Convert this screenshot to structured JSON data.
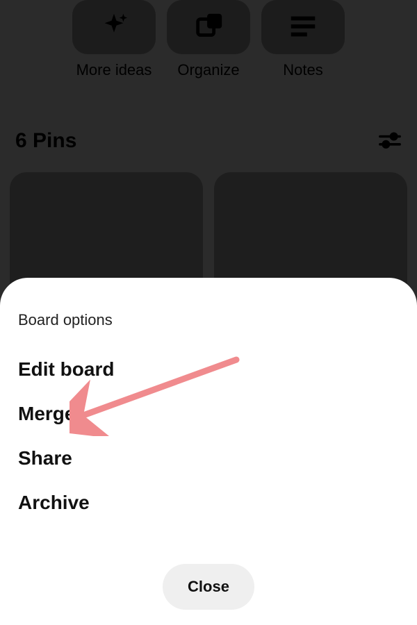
{
  "actions": {
    "more_ideas": "More ideas",
    "organize": "Organize",
    "notes": "Notes"
  },
  "pins_header": {
    "count_label": "6 Pins"
  },
  "sheet": {
    "title": "Board options",
    "edit_board": "Edit board",
    "merge": "Merge",
    "share": "Share",
    "archive": "Archive",
    "close": "Close"
  },
  "annotation": {
    "arrow_color": "#f08b8e",
    "points_to": "merge"
  }
}
